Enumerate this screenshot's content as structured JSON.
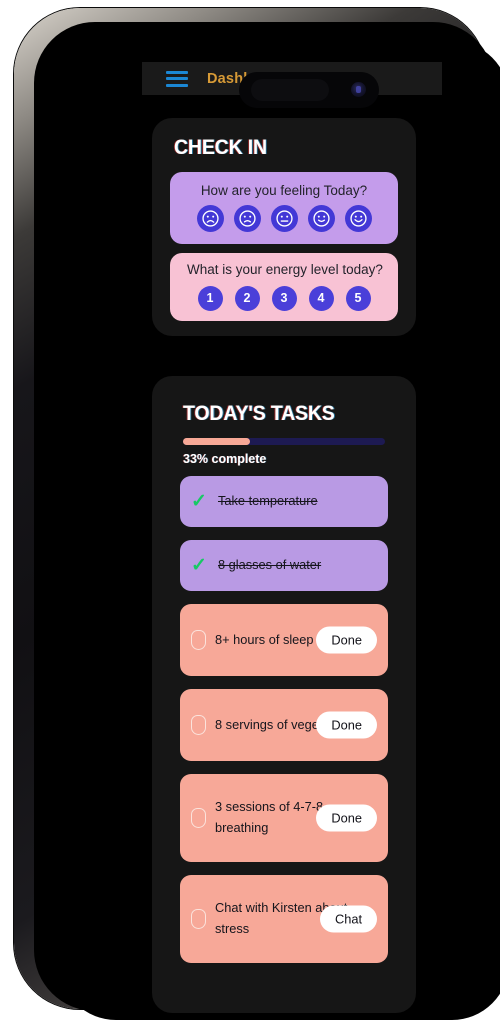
{
  "app_bar": {
    "menu_icon": "hamburger-menu-icon",
    "title": "Dashboard",
    "title_color": "#d79a36",
    "menu_color": "#1b87d4"
  },
  "checkin": {
    "section_title": "CHECK IN",
    "mood": {
      "question": "How are you feeling Today?",
      "card_color": "#c49ceb",
      "options": [
        {
          "id": "mood-1",
          "name": "mood-very-sad",
          "face": "frown"
        },
        {
          "id": "mood-2",
          "name": "mood-sad",
          "face": "frown"
        },
        {
          "id": "mood-3",
          "name": "mood-neutral",
          "face": "neutral"
        },
        {
          "id": "mood-4",
          "name": "mood-happy",
          "face": "smile"
        },
        {
          "id": "mood-5",
          "name": "mood-very-happy",
          "face": "smile"
        }
      ]
    },
    "energy": {
      "question": "What is your energy level today?",
      "card_color": "#f8c2d4",
      "options": [
        "1",
        "2",
        "3",
        "4",
        "5"
      ]
    }
  },
  "tasks": {
    "section_title": "TODAY'S TASKS",
    "progress_percent": 33,
    "progress_label": "33% complete",
    "progress_fill_color": "#f7a896",
    "progress_track_color": "#1d1a52",
    "items": [
      {
        "label": "Take temperature",
        "completed": true,
        "action": null,
        "lines": 1,
        "card_color": "#b99ae4"
      },
      {
        "label": "8 glasses of water",
        "completed": true,
        "action": null,
        "lines": 1,
        "card_color": "#b99ae4"
      },
      {
        "label": "8+ hours of sleep",
        "completed": false,
        "action": "Done",
        "lines": 2,
        "card_color": "#f7a898"
      },
      {
        "label": "8 servings of vegetables",
        "completed": false,
        "action": "Done",
        "lines": 2,
        "card_color": "#f7a898"
      },
      {
        "label": "3 sessions of 4-7-8 breathing",
        "completed": false,
        "action": "Done",
        "lines": 3,
        "card_color": "#f7a898"
      },
      {
        "label": "Chat with Kirsten about stress",
        "completed": false,
        "action": "Chat",
        "lines": 3,
        "card_color": "#f7a898"
      }
    ]
  }
}
